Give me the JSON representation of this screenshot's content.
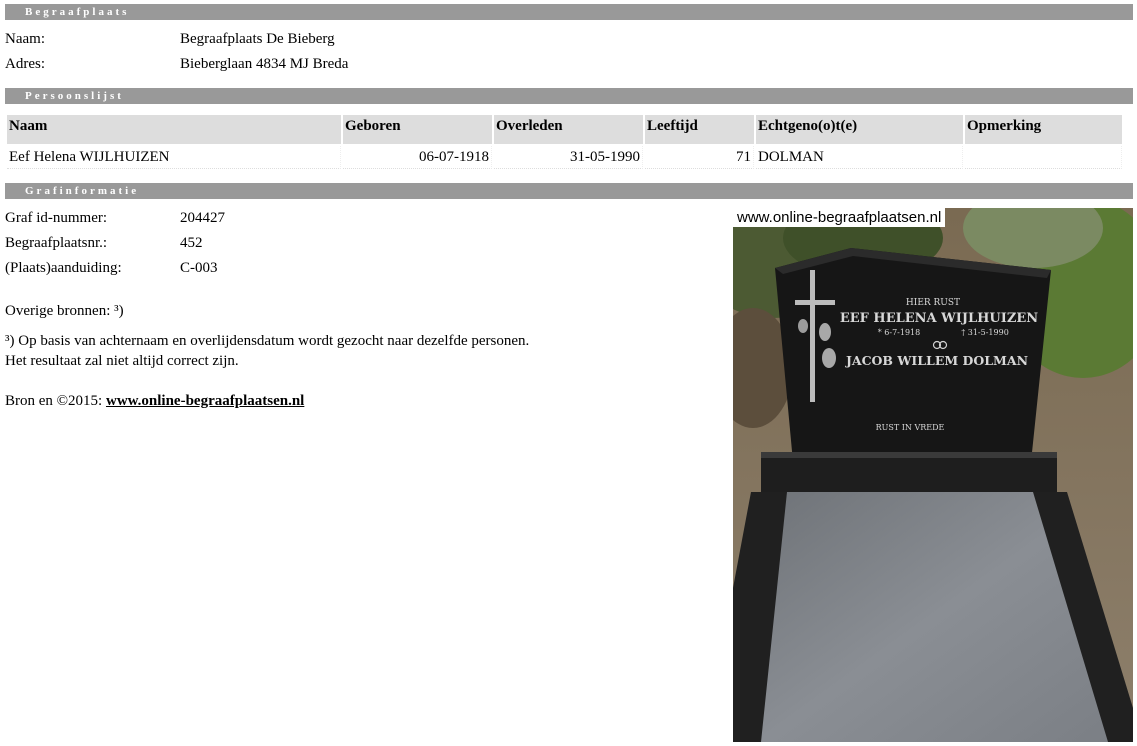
{
  "sections": {
    "begraafplaats": "Begraafplaats",
    "persoonslijst": "Persoonslijst",
    "grafinformatie": "Grafinformatie"
  },
  "cemetery": {
    "naam_label": "Naam:",
    "naam_value": "Begraafplaats De Bieberg",
    "adres_label": "Adres:",
    "adres_value": "Bieberglaan 4834 MJ Breda"
  },
  "persons": {
    "headers": [
      "Naam",
      "Geboren",
      "Overleden",
      "Leeftijd",
      "Echtgeno(o)t(e)",
      "Opmerking"
    ],
    "rows": [
      {
        "naam": "Eef Helena WIJLHUIZEN",
        "geboren": "06-07-1918",
        "overleden": "31-05-1990",
        "leeftijd": "71",
        "echtgenoot": "DOLMAN",
        "opmerking": ""
      }
    ]
  },
  "grave": {
    "graf_id_label": "Graf id-nummer:",
    "graf_id_value": "204427",
    "nr_label": "Begraafplaatsnr.:",
    "nr_value": "452",
    "aanduiding_label": "(Plaats)aanduiding:",
    "aanduiding_value": "C-003",
    "overige": "Overige bronnen: ³)",
    "note_line1": "³) Op basis van achternaam en overlijdensdatum wordt gezocht naar dezelfde personen.",
    "note_line2": "Het resultaat zal niet altijd correct zijn.",
    "bron_prefix": "Bron en ©2015: ",
    "bron_link": "www.online-begraafplaatsen.nl"
  },
  "photo": {
    "watermark": "www.online-begraafplaatsen.nl",
    "inscription": {
      "line1": "HIER RUST",
      "line2": "EEF HELENA WIJLHUIZEN",
      "line3a": "* 6-7-1918",
      "line3b": "† 31-5-1990",
      "line4": "JACOB WILLEM DOLMAN",
      "line5": "RUST IN VREDE"
    }
  }
}
